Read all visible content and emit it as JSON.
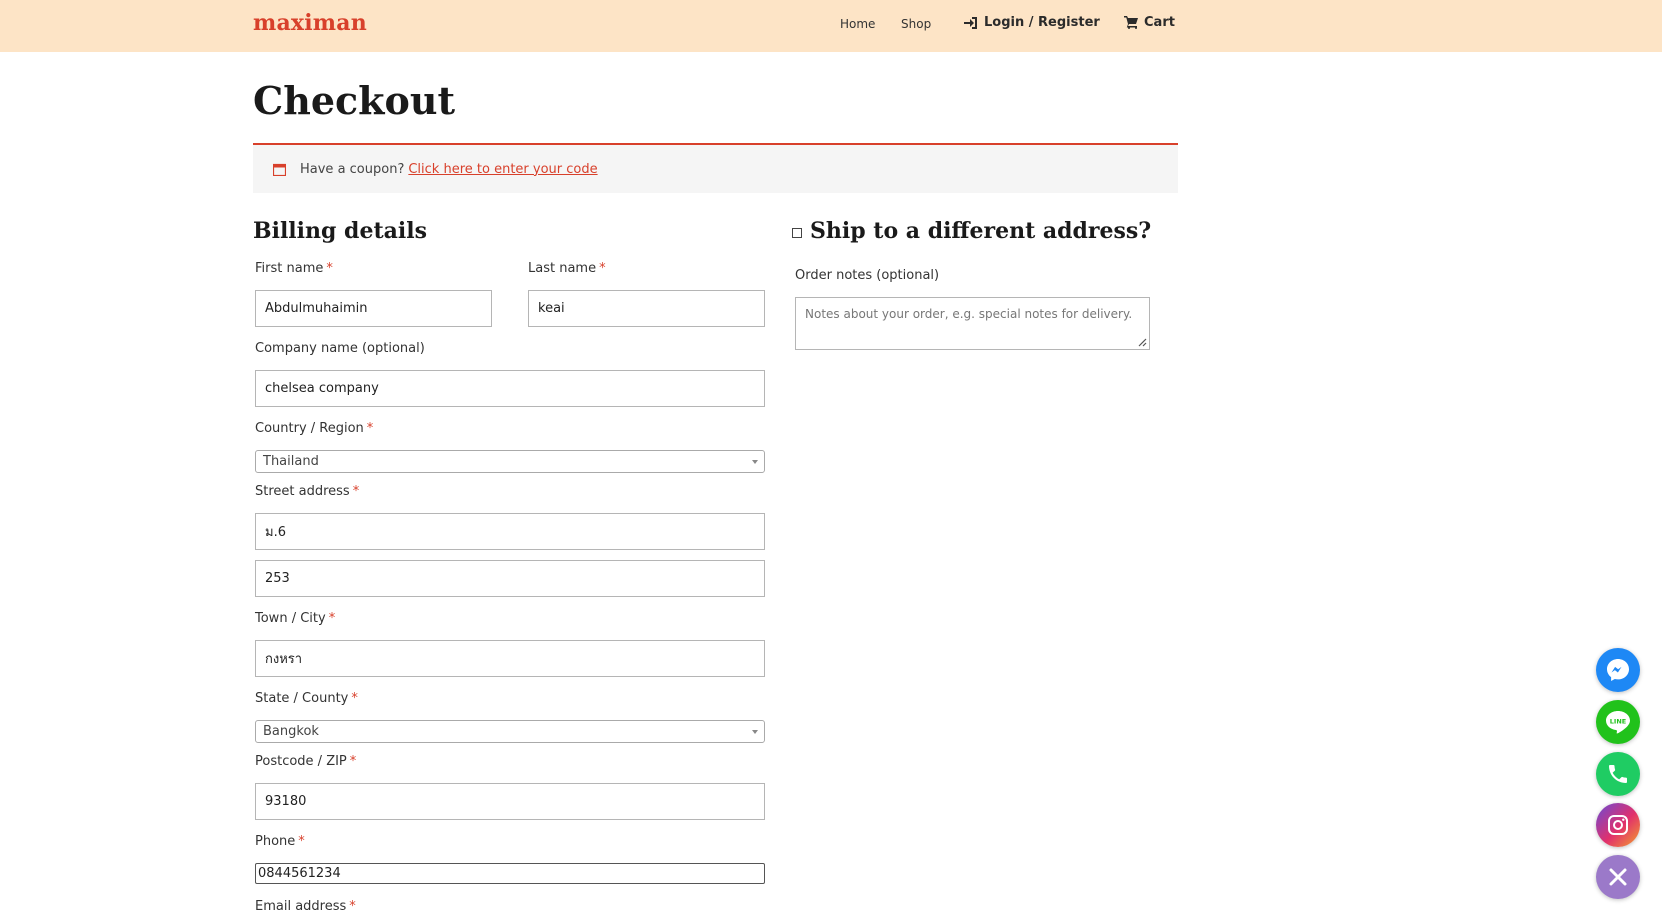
{
  "header": {
    "logo": "maximan",
    "nav": {
      "home": "Home",
      "shop": "Shop",
      "login": "Login / Register",
      "cart": "Cart"
    }
  },
  "page": {
    "title": "Checkout"
  },
  "coupon": {
    "text": "Have a coupon?",
    "link": "Click here to enter your code"
  },
  "billing": {
    "heading": "Billing details",
    "required_mark": "*",
    "first_name": {
      "label": "First name",
      "value": "Abdulmuhaimin"
    },
    "last_name": {
      "label": "Last name",
      "value": "keai"
    },
    "company": {
      "label": "Company name (optional)",
      "value": "chelsea company"
    },
    "country": {
      "label": "Country / Region",
      "value": "Thailand"
    },
    "street": {
      "label": "Street address",
      "value1": "ม.6",
      "value2": "253"
    },
    "city": {
      "label": "Town / City",
      "value": "กงหรา"
    },
    "state": {
      "label": "State / County",
      "value": "Bangkok"
    },
    "postcode": {
      "label": "Postcode / ZIP",
      "value": "93180"
    },
    "phone": {
      "label": "Phone",
      "value": "0844561234"
    },
    "email": {
      "label": "Email address"
    }
  },
  "shipping": {
    "heading": "Ship to a different address?",
    "notes_label": "Order notes (optional)",
    "notes_placeholder": "Notes about your order, e.g. special notes for delivery."
  },
  "social": {
    "colors": {
      "messenger": "#1e88f5",
      "line": "#21c21b",
      "phone": "#1fcc63",
      "instagram": "#e1306c",
      "close": "#9b79c9"
    },
    "icons": [
      "messenger-icon",
      "line-icon",
      "phone-icon",
      "instagram-icon",
      "close-icon"
    ],
    "line_label": "LINE"
  },
  "accent": "#d8402b"
}
